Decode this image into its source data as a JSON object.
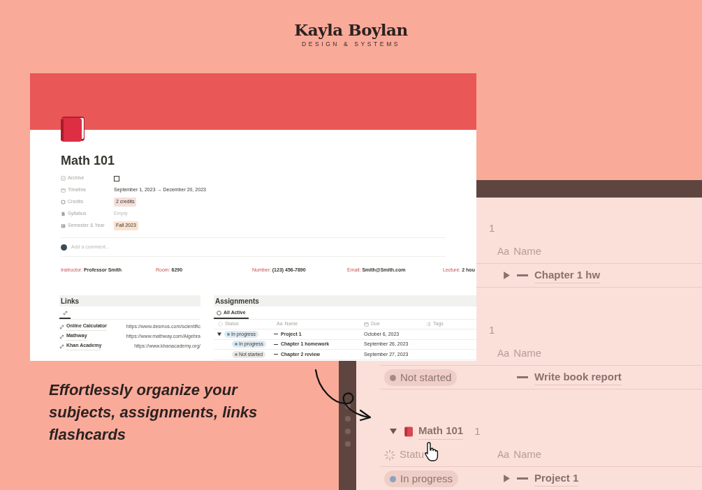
{
  "brand": {
    "name": "Kayla Boylan",
    "tagline": "DESIGN & SYSTEMS"
  },
  "page": {
    "title": "Math 101",
    "properties": [
      {
        "kind": "checkbox",
        "label": "Archive",
        "checked": false
      },
      {
        "kind": "date",
        "label": "Timeline",
        "value": "September 1, 2023 → December 20, 2023"
      },
      {
        "kind": "tag",
        "label": "Credits",
        "value": "2 credits",
        "color": "#f4dfdb"
      },
      {
        "kind": "empty",
        "label": "Syllabus",
        "value": "Empty"
      },
      {
        "kind": "tag",
        "label": "Semester & Year",
        "value": "Fall 2023",
        "color": "#fbe2cf"
      }
    ],
    "comment": {
      "placeholder": "Add a comment..."
    },
    "info": [
      {
        "label": "Instructor:",
        "value": "Professor Smith"
      },
      {
        "label": "Room:",
        "value": "6290"
      },
      {
        "label": "Number:",
        "value": "(123) 456-7890"
      },
      {
        "label": "Email:",
        "value": "Smith@Smith.com"
      },
      {
        "label": "Lecture:",
        "value": "2 hou"
      }
    ],
    "links": {
      "title": "Links",
      "items": [
        {
          "name": "Online Calculator",
          "url": "https://www.desmos.com/scientific"
        },
        {
          "name": "Mathway",
          "url": "https://www.mathway.com/Algebra"
        },
        {
          "name": "Khan Academy",
          "url": "https://www.khanacademy.org/"
        }
      ]
    },
    "assignments": {
      "title": "Assignments",
      "view": "All Active",
      "name_icon_text": "Aa",
      "columns": [
        "Status",
        "Name",
        "Due",
        "Tags"
      ],
      "rows": [
        {
          "expanded": true,
          "status": "In progress",
          "color": "#5b97bd",
          "name": "Project 1",
          "due": "October 6, 2023",
          "children": [
            {
              "status": "In progress",
              "color": "#5b97bd",
              "name": "Chapter 1 homework",
              "due": "September 26, 2023"
            },
            {
              "status": "Not started",
              "color": "#91918e",
              "name": "Chapter 2 review",
              "due": "September 27, 2023"
            }
          ]
        }
      ]
    }
  },
  "background_view": {
    "rows": [
      {
        "kind": "count",
        "text": "1"
      },
      {
        "kind": "header",
        "icon_text": "Aa",
        "label": "Name"
      },
      {
        "kind": "task",
        "expanded": false,
        "name": "Chapter 1 hw"
      },
      {
        "kind": "count",
        "text": "1"
      },
      {
        "kind": "header",
        "icon_text": "Aa",
        "label": "Name"
      },
      {
        "kind": "task",
        "status": "Not started",
        "color": "#a38c88",
        "name": "Write book report"
      },
      {
        "kind": "group",
        "expanded": true,
        "name": "Math 101",
        "count": "1"
      },
      {
        "kind": "header",
        "status_label": "Statu",
        "icon_text": "Aa",
        "label": "Name"
      },
      {
        "kind": "task",
        "status": "In progress",
        "color": "#8ea2bb",
        "expanded": false,
        "name": "Project 1"
      }
    ]
  },
  "headline": {
    "lines": [
      "Effortlessly organize your",
      "subjects, assignments, links",
      "flashcards"
    ]
  }
}
